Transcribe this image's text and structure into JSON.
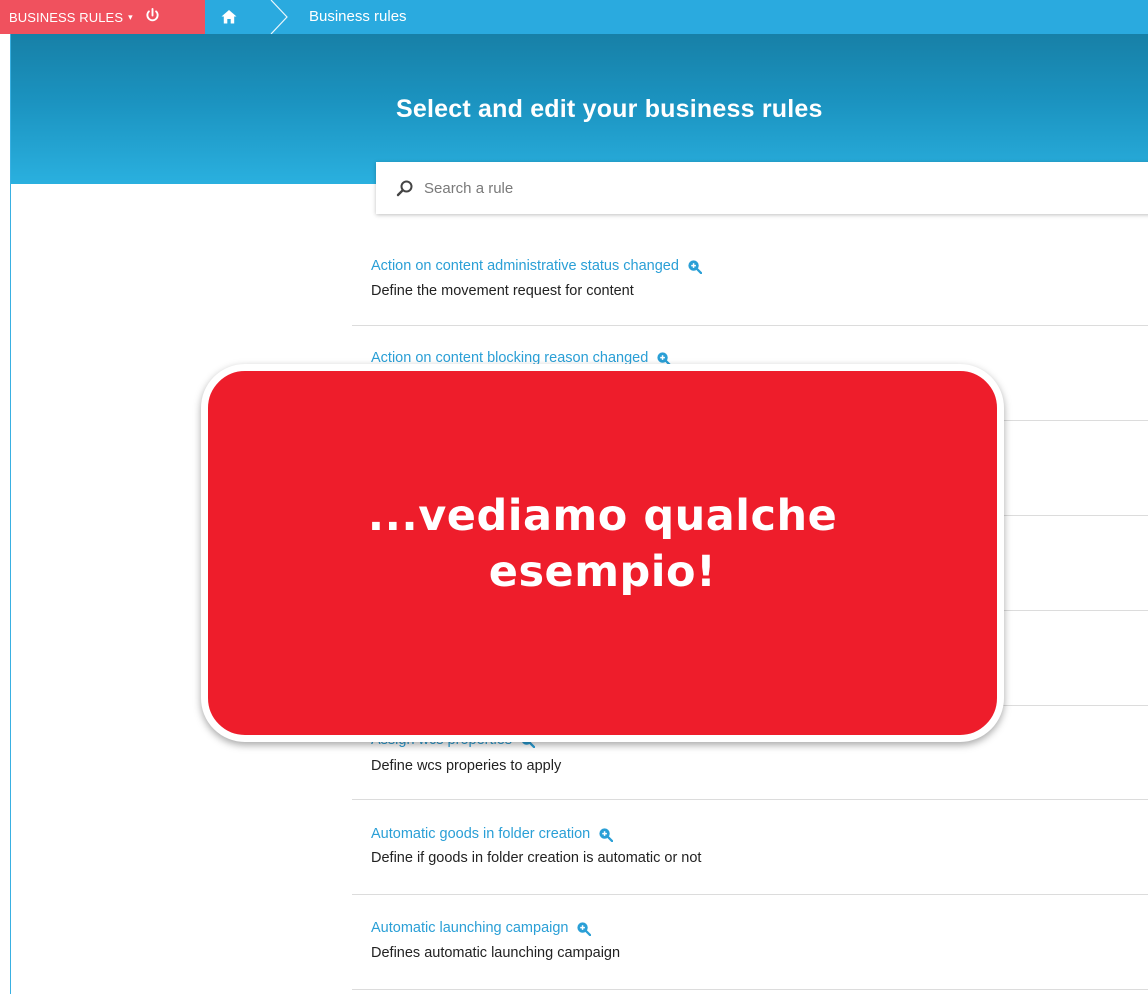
{
  "topbar": {
    "module_label": "BUSINESS RULES",
    "caret": "▾",
    "power_icon": "power-icon",
    "home_icon": "home-icon",
    "breadcrumb": "Business rules",
    "module_color": "#f0515e",
    "bar_color": "#2aaadf"
  },
  "hero": {
    "title": "Select and edit your business rules"
  },
  "search": {
    "placeholder": "Search a rule",
    "value": ""
  },
  "rules": [
    {
      "title": "Action on content administrative status changed",
      "description": "Define the movement request for content"
    },
    {
      "title": "Action on content blocking reason changed",
      "description": ""
    },
    {
      "title": "",
      "description": ""
    },
    {
      "title": "",
      "description": ""
    },
    {
      "title": "",
      "description": ""
    },
    {
      "title": "Assign wcs properties",
      "description": "Define wcs properies to apply"
    },
    {
      "title": "Automatic goods in folder creation",
      "description": "Define if goods in folder creation is automatic or not"
    },
    {
      "title": "Automatic launching campaign",
      "description": "Defines automatic launching campaign"
    }
  ],
  "overlay": {
    "text": "...vediamo qualche esempio!",
    "color": "#ee1d2b"
  }
}
